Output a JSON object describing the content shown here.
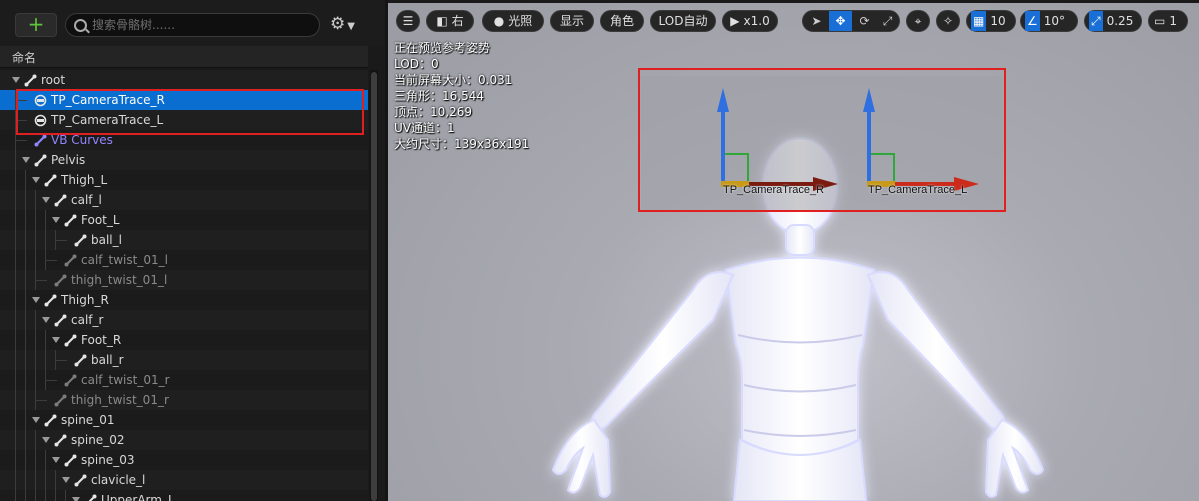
{
  "left_panel": {
    "add_label": "+",
    "search_placeholder": "搜索骨骼树......",
    "settings_icon": "gear-icon",
    "column_header": "命名",
    "tree": [
      {
        "label": "root",
        "depth": 0,
        "type": "bone",
        "expanded": true
      },
      {
        "label": "TP_CameraTrace_R",
        "depth": 1,
        "type": "socket",
        "selected": true
      },
      {
        "label": "TP_CameraTrace_L",
        "depth": 1,
        "type": "socket"
      },
      {
        "label": "VB Curves",
        "depth": 1,
        "type": "curve"
      },
      {
        "label": "Pelvis",
        "depth": 1,
        "type": "bone",
        "expanded": true
      },
      {
        "label": "Thigh_L",
        "depth": 2,
        "type": "bone",
        "expanded": true
      },
      {
        "label": "calf_l",
        "depth": 3,
        "type": "bone",
        "expanded": true
      },
      {
        "label": "Foot_L",
        "depth": 4,
        "type": "bone",
        "expanded": true
      },
      {
        "label": "ball_l",
        "depth": 5,
        "type": "bone"
      },
      {
        "label": "calf_twist_01_l",
        "depth": 4,
        "type": "bone-dim"
      },
      {
        "label": "thigh_twist_01_l",
        "depth": 3,
        "type": "bone-dim"
      },
      {
        "label": "Thigh_R",
        "depth": 2,
        "type": "bone",
        "expanded": true
      },
      {
        "label": "calf_r",
        "depth": 3,
        "type": "bone",
        "expanded": true
      },
      {
        "label": "Foot_R",
        "depth": 4,
        "type": "bone",
        "expanded": true
      },
      {
        "label": "ball_r",
        "depth": 5,
        "type": "bone"
      },
      {
        "label": "calf_twist_01_r",
        "depth": 4,
        "type": "bone-dim"
      },
      {
        "label": "thigh_twist_01_r",
        "depth": 3,
        "type": "bone-dim"
      },
      {
        "label": "spine_01",
        "depth": 2,
        "type": "bone",
        "expanded": true
      },
      {
        "label": "spine_02",
        "depth": 3,
        "type": "bone",
        "expanded": true
      },
      {
        "label": "spine_03",
        "depth": 4,
        "type": "bone",
        "expanded": true
      },
      {
        "label": "clavicle_l",
        "depth": 5,
        "type": "bone",
        "expanded": true
      },
      {
        "label": "UpperArm_L",
        "depth": 6,
        "type": "bone",
        "expanded": true
      }
    ]
  },
  "viewport": {
    "toolbar": {
      "menu_icon": "hamburger-icon",
      "view_label": "右",
      "lighting_label": "光照",
      "show_label": "显示",
      "character_label": "角色",
      "lod_label": "LOD自动",
      "play_label": "x1.0",
      "grid_snap_value": "10",
      "rotation_snap_value": "10°",
      "scale_snap_value": "0.25",
      "camera_speed_value": "1"
    },
    "stats": [
      "正在预览参考姿势",
      "LOD：0",
      "当前屏幕大小：0.031",
      "三角形：16,544",
      "顶点：10,269",
      "UV通道：1",
      "大约尺寸：139x36x191"
    ],
    "gizmo_labels": {
      "right": "TP_CameraTrace_R",
      "left": "TP_CameraTrace_L"
    },
    "colors": {
      "selection": "#0a6ed1",
      "highlight": "#e02020",
      "axis_z": "#2f6fe0",
      "axis_x": "#cc2a1a",
      "axis_y": "#3ab03a"
    }
  }
}
